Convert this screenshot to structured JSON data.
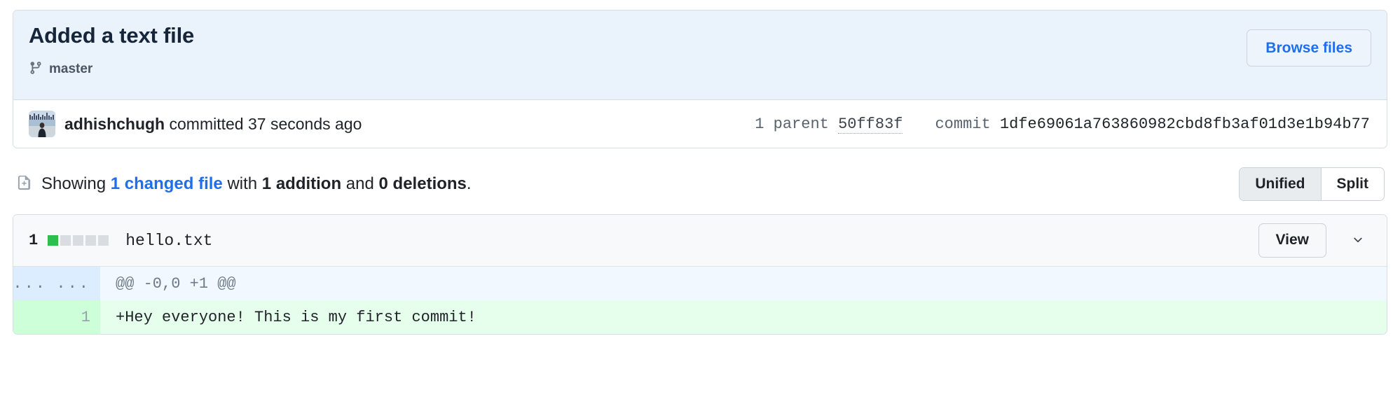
{
  "commit": {
    "title": "Added a text file",
    "branch_icon": "git-branch-icon",
    "branch": "master",
    "browse_files_label": "Browse files",
    "author": "adhishchugh",
    "committed_text": " committed 37 seconds ago",
    "parent_label": "1 parent",
    "parent_sha": "50ff83f",
    "commit_label": "commit",
    "commit_sha": "1dfe69061a763860982cbd8fb3af01d3e1b94b77"
  },
  "summary": {
    "icon": "file-diff-icon",
    "prefix": "Showing ",
    "changed_files": "1 changed file",
    "with": " with ",
    "additions": "1 addition",
    "and": " and ",
    "deletions": "0 deletions",
    "suffix": ".",
    "view_unified": "Unified",
    "view_split": "Split",
    "selected_view": "Unified"
  },
  "file": {
    "change_count": "1",
    "stat_blocks": [
      "add",
      "neutral",
      "neutral",
      "neutral",
      "neutral"
    ],
    "name": "hello.txt",
    "view_label": "View",
    "chevron_icon": "chevron-down-icon"
  },
  "diff": {
    "hunk_gutter_old": "...",
    "hunk_gutter_new": "...",
    "hunk_header": "@@ -0,0 +1 @@",
    "line_gutter_old": "",
    "line_gutter_new": "1",
    "line_content": "+Hey everyone! This is my first commit!"
  },
  "colors": {
    "header_bg": "#eaf2fb",
    "link_blue": "#1f6feb",
    "addition_green": "#e6ffed",
    "addition_gutter_green": "#cdffd8",
    "hunk_blue": "#f1f8ff",
    "stat_add_green": "#2cbe4e"
  }
}
